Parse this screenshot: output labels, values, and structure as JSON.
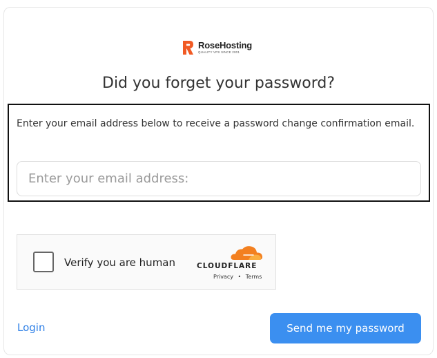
{
  "brand": {
    "name": "RoseHosting",
    "tagline": "QUALITY VPS SINCE 2001",
    "color": "#f15a24"
  },
  "form": {
    "title": "Did you forget your password?",
    "description": "Enter your email address below to receive a password change confirmation email.",
    "email": {
      "value": "",
      "placeholder": "Enter your email address:"
    }
  },
  "captcha": {
    "label": "Verify you are human",
    "checked": false,
    "provider": "CLOUDFLARE",
    "privacy": "Privacy",
    "separator": "•",
    "terms": "Terms",
    "cloud_color": "#f38020"
  },
  "actions": {
    "login": "Login",
    "send": "Send me my password",
    "link_color": "#2c7ee6",
    "button_color": "#3b8ff0"
  }
}
